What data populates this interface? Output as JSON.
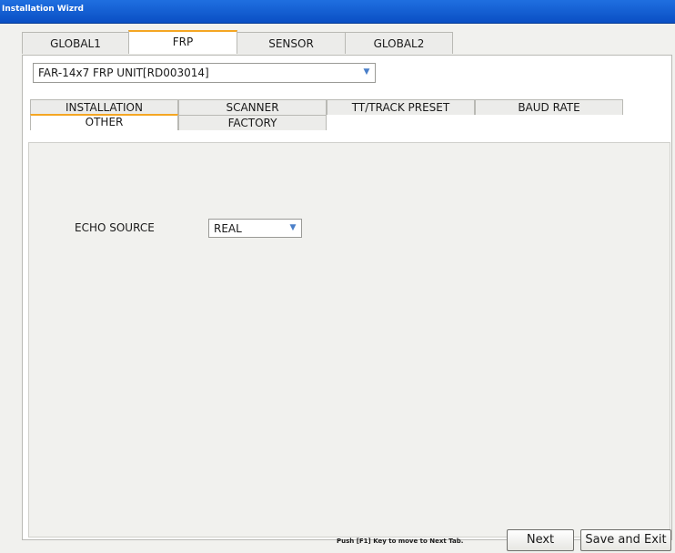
{
  "window": {
    "title": "Installation Wizrd"
  },
  "top_tabs": [
    {
      "label": "GLOBAL1",
      "active": false
    },
    {
      "label": "FRP",
      "active": true
    },
    {
      "label": "SENSOR",
      "active": false
    },
    {
      "label": "GLOBAL2",
      "active": false
    }
  ],
  "unit_select": {
    "value": "FAR-14x7 FRP UNIT[RD003014]",
    "icon": "chevron-down-icon"
  },
  "sub_tabs_row1": [
    {
      "label": "INSTALLATION"
    },
    {
      "label": "SCANNER"
    },
    {
      "label": "TT/TRACK PRESET"
    },
    {
      "label": "BAUD RATE"
    }
  ],
  "sub_tabs_row2": [
    {
      "label": "OTHER",
      "active": true
    },
    {
      "label": "FACTORY",
      "active": false
    }
  ],
  "echo_source": {
    "label": "ECHO SOURCE",
    "value": "REAL",
    "icon": "chevron-down-icon"
  },
  "footer": {
    "hint": "Push [F1] Key to move to Next Tab.",
    "next_label": "Next",
    "save_exit_label": "Save and Exit"
  },
  "colors": {
    "titlebar": "#0a4fc4",
    "active_tab_accent": "#f5a623",
    "dropdown_arrow": "#4a7fc9"
  }
}
